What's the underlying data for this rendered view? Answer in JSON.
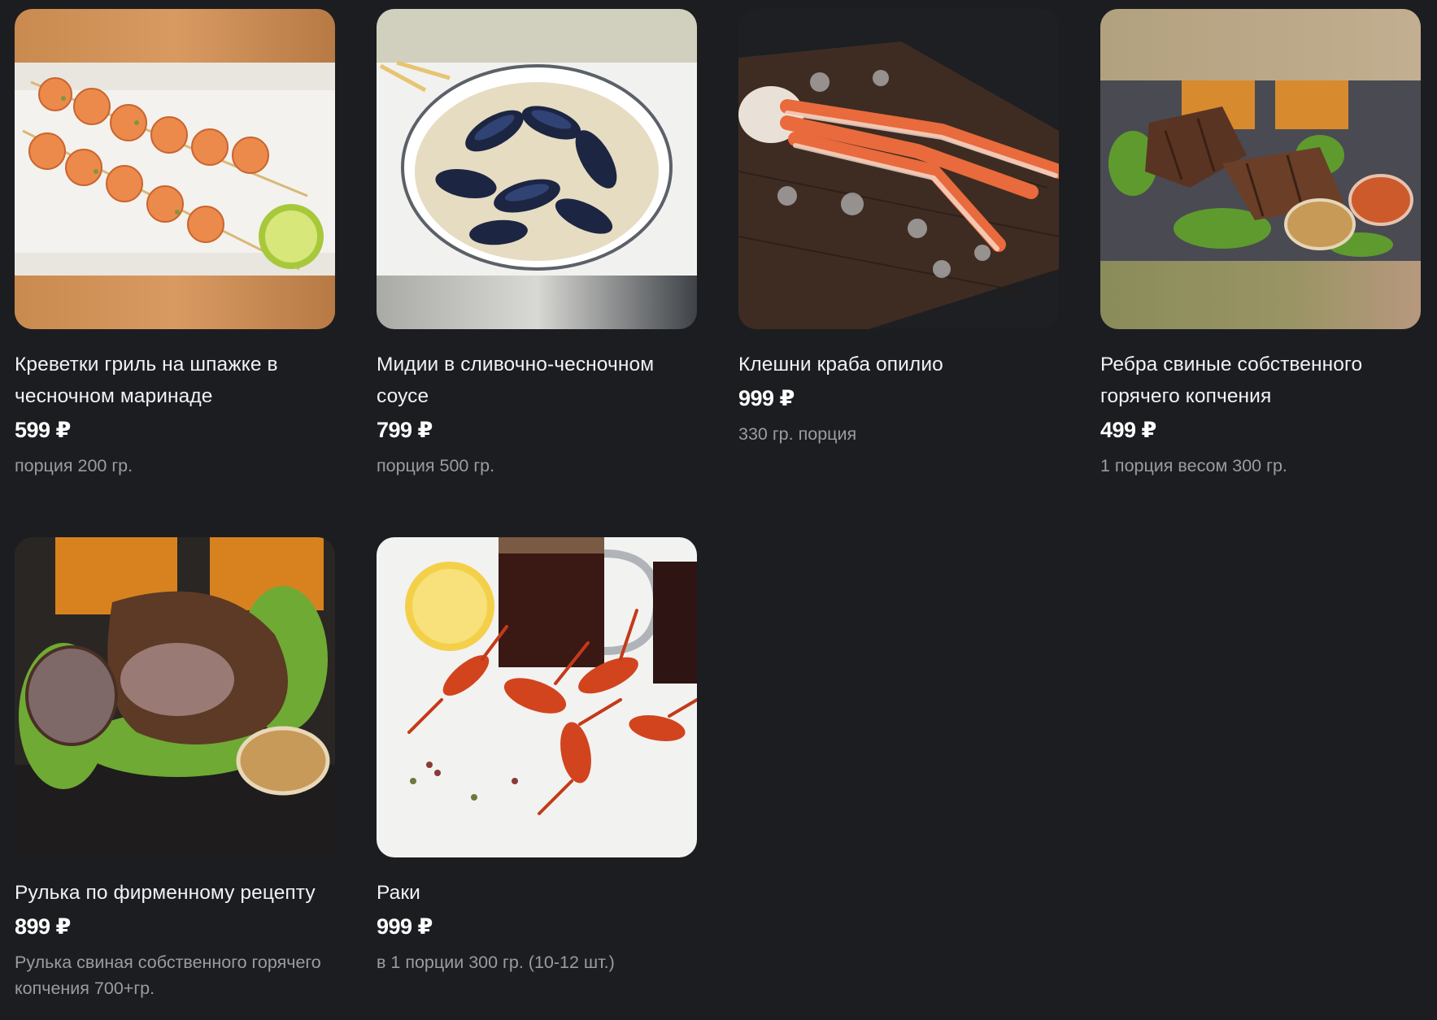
{
  "products": [
    {
      "title": "Креветки гриль на шпажке в чесночном маринаде",
      "price": "599 ₽",
      "desc": "порция 200 гр.",
      "image_icon": "grilled-shrimp-skewers-image"
    },
    {
      "title": "Мидии в сливочно-чесночном соусе",
      "price": "799 ₽",
      "desc": "порция 500 гр.",
      "image_icon": "mussels-in-cream-sauce-image"
    },
    {
      "title": "Клешни краба опилио",
      "price": "999 ₽",
      "desc": "330 гр. порция",
      "image_icon": "snow-crab-legs-image"
    },
    {
      "title": "Ребра свиные собственного горячего копчения",
      "price": "499 ₽",
      "desc": "1 порция весом 300 гр.",
      "image_icon": "smoked-pork-ribs-image"
    },
    {
      "title": "Рулька по фирменному рецепту",
      "price": "899 ₽",
      "desc": "Рулька свиная собственного горячего копчения 700+гр.",
      "image_icon": "pork-knuckle-image"
    },
    {
      "title": "Раки",
      "price": "999 ₽",
      "desc": "в 1 порции 300 гр. (10-12 шт.)",
      "image_icon": "crayfish-with-beer-image"
    }
  ]
}
